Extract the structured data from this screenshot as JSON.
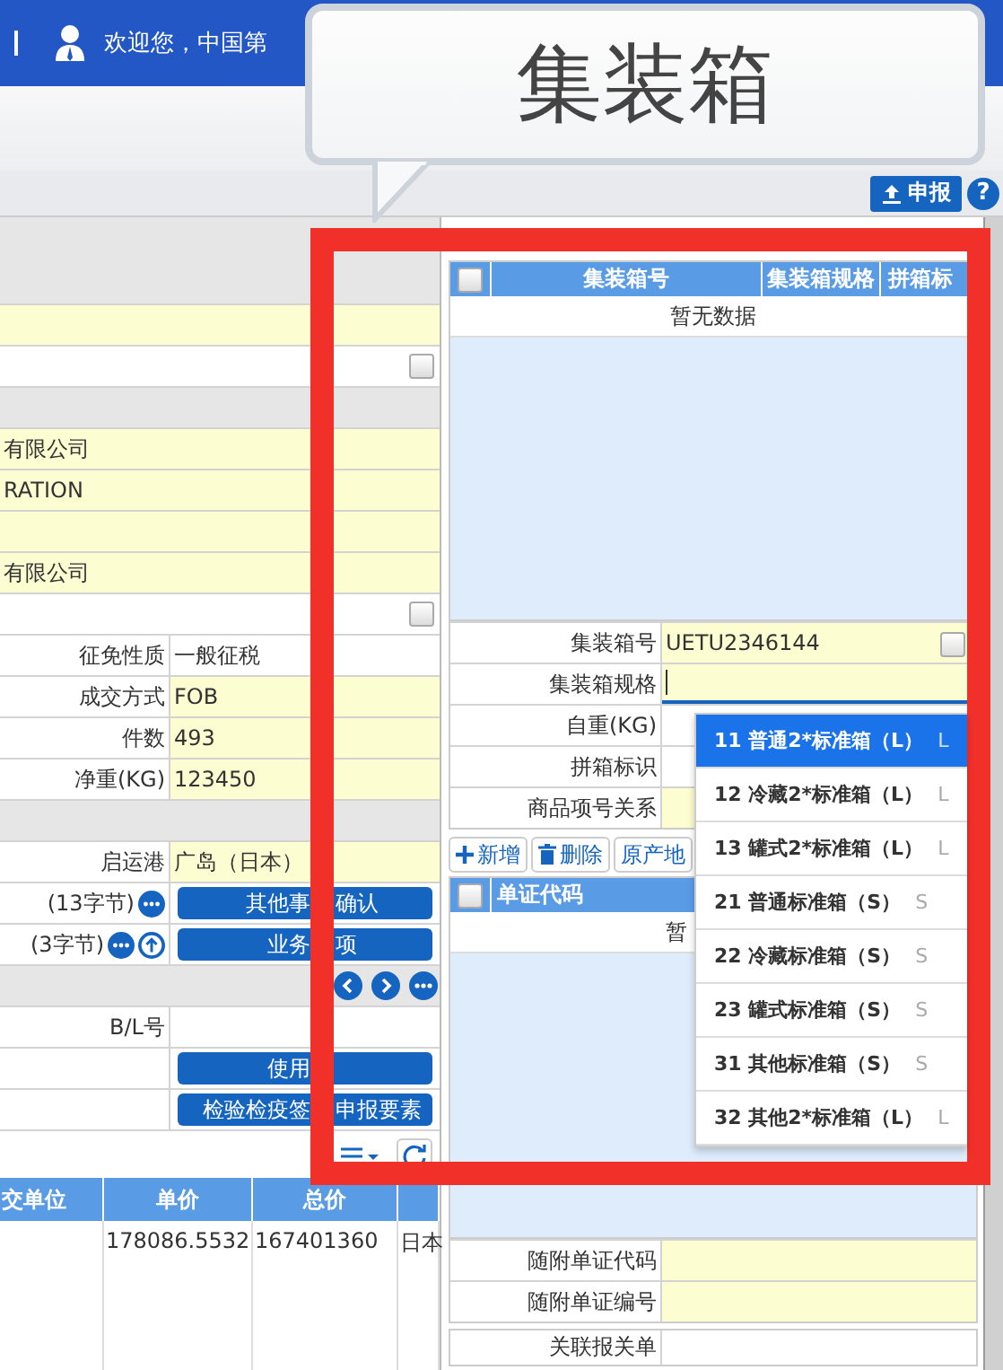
{
  "header": {
    "welcome": "欢迎您，中国第"
  },
  "callout": {
    "text": "集装箱"
  },
  "toolbar": {
    "declare_button": "申报",
    "help": "?"
  },
  "left_form": {
    "rows": [
      {
        "kind": "section"
      },
      {
        "kind": "field",
        "required": true
      },
      {
        "kind": "check",
        "checked": false
      },
      {
        "kind": "section"
      },
      {
        "kind": "field",
        "required": true,
        "value": "有限公司"
      },
      {
        "kind": "field",
        "required": true,
        "value": "RATION"
      },
      {
        "kind": "field",
        "required": true
      },
      {
        "kind": "field",
        "required": true,
        "value": "有限公司"
      },
      {
        "kind": "check",
        "checked": false
      },
      {
        "kind": "field",
        "required": false,
        "label": "征免性质",
        "value": "一般征税"
      },
      {
        "kind": "field",
        "required": true,
        "label": "成交方式",
        "value": "FOB"
      },
      {
        "kind": "field",
        "required": true,
        "label": "件数",
        "value": "493"
      },
      {
        "kind": "field",
        "required": true,
        "label": "净重(KG)",
        "value": "123450"
      },
      {
        "kind": "section"
      },
      {
        "kind": "field",
        "required": true,
        "label": "启运港",
        "value": "广岛（日本）"
      },
      {
        "kind": "bytes",
        "label": "(13字节)",
        "upload": false,
        "button": [
          "其他事",
          "确认"
        ]
      },
      {
        "kind": "bytes",
        "label": "(3字节)",
        "upload": true,
        "button": [
          "业务",
          "项"
        ]
      },
      {
        "kind": "nav"
      },
      {
        "kind": "field",
        "required": false,
        "label": "B/L号"
      },
      {
        "kind": "button",
        "button": [
          "使用"
        ]
      },
      {
        "kind": "button",
        "button": [
          "检验检疫签",
          "申报要素"
        ]
      }
    ]
  },
  "goods_table": {
    "columns": [
      "交单位",
      "单价",
      "总价"
    ],
    "rows": [
      {
        "cells": [
          "",
          "178086.5532",
          "167401360",
          "日本"
        ]
      }
    ]
  },
  "container_table": {
    "checked": false,
    "columns": [
      "集装箱号",
      "集装箱规格",
      "拼箱标"
    ],
    "empty": "暂无数据"
  },
  "container_form": [
    {
      "label": "集装箱号",
      "value": "UETU2346144",
      "required": true,
      "focused": false,
      "checked": false
    },
    {
      "label": "集装箱规格",
      "required": true,
      "focused": true
    },
    {
      "label": "自重(KG)",
      "required": false,
      "focused": false
    },
    {
      "label": "拼箱标识",
      "required": false,
      "focused": false
    },
    {
      "label": "商品项号关系",
      "required": true,
      "focused": false
    }
  ],
  "doc_toolbar": [
    {
      "label": "新增",
      "kind": "add"
    },
    {
      "label": "删除",
      "kind": "delete"
    },
    {
      "label": "原产地",
      "kind": "text"
    }
  ],
  "doc_table": {
    "checked": false,
    "columns": [
      "单证代码"
    ],
    "empty": "暂"
  },
  "doc_form": [
    {
      "label": "随附单证代码",
      "required": true
    },
    {
      "label": "随附单证编号",
      "required": true
    }
  ],
  "related": {
    "label": "关联报关单"
  },
  "dropdown": {
    "items": [
      {
        "name": "11 普通2*标准箱（L）",
        "size": "L",
        "selected": true
      },
      {
        "name": "12 冷藏2*标准箱（L）",
        "size": "L",
        "selected": false
      },
      {
        "name": "13 罐式2*标准箱（L）",
        "size": "L",
        "selected": false
      },
      {
        "name": "21 普通标准箱（S）",
        "size": "S",
        "selected": false
      },
      {
        "name": "22 冷藏标准箱（S）",
        "size": "S",
        "selected": false
      },
      {
        "name": "23 罐式标准箱（S）",
        "size": "S",
        "selected": false
      },
      {
        "name": "31 其他标准箱（S）",
        "size": "S",
        "selected": false
      },
      {
        "name": "32 其他2*标准箱（L）",
        "size": "L",
        "selected": false
      }
    ]
  }
}
